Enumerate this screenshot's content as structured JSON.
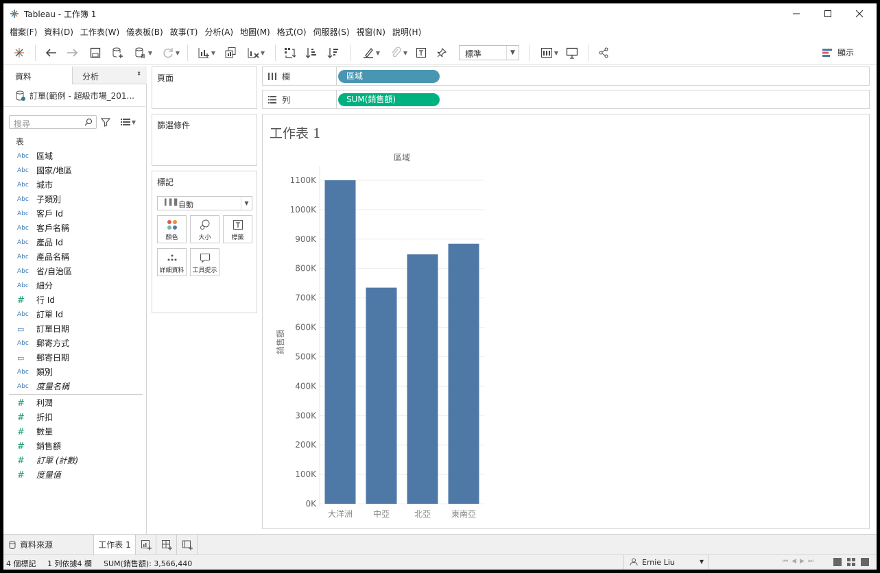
{
  "window": {
    "title": "Tableau - 工作簿 1"
  },
  "menu": [
    "檔案(F)",
    "資料(D)",
    "工作表(W)",
    "儀表板(B)",
    "故事(T)",
    "分析(A)",
    "地圖(M)",
    "格式(O)",
    "伺服器(S)",
    "視窗(N)",
    "說明(H)"
  ],
  "toolbar": {
    "fit_value": "標準",
    "show_me_label": "顯示"
  },
  "data_pane": {
    "tabs": [
      "資料",
      "分析"
    ],
    "datasource": "訂單(範例 - 超級市場_201...",
    "search_placeholder": "搜尋",
    "tables_label": "表",
    "dimensions": [
      {
        "type": "Abc",
        "name": "區域"
      },
      {
        "type": "Abc",
        "name": "國家/地區"
      },
      {
        "type": "Abc",
        "name": "城市"
      },
      {
        "type": "Abc",
        "name": "子類別"
      },
      {
        "type": "Abc",
        "name": "客戶 Id"
      },
      {
        "type": "Abc",
        "name": "客戶名稱"
      },
      {
        "type": "Abc",
        "name": "產品 Id"
      },
      {
        "type": "Abc",
        "name": "產品名稱"
      },
      {
        "type": "Abc",
        "name": "省/自治區"
      },
      {
        "type": "Abc",
        "name": "細分"
      },
      {
        "type": "#",
        "name": "行 Id"
      },
      {
        "type": "Abc",
        "name": "訂單 Id"
      },
      {
        "type": "date",
        "name": "訂單日期"
      },
      {
        "type": "Abc",
        "name": "郵寄方式"
      },
      {
        "type": "date",
        "name": "郵寄日期"
      },
      {
        "type": "Abc",
        "name": "類別"
      },
      {
        "type": "Abc",
        "name": "度量名稱",
        "italic": true
      }
    ],
    "measures": [
      {
        "type": "#",
        "name": "利潤"
      },
      {
        "type": "#",
        "name": "折扣"
      },
      {
        "type": "#",
        "name": "數量"
      },
      {
        "type": "#",
        "name": "銷售額"
      },
      {
        "type": "#",
        "name": "訂單 (計數)",
        "italic": true
      },
      {
        "type": "#",
        "name": "度量值",
        "italic": true
      }
    ]
  },
  "cards": {
    "pages_title": "頁面",
    "filters_title": "篩選條件",
    "marks_title": "標記",
    "mark_type": "自動",
    "buttons": [
      "顏色",
      "大小",
      "標籤",
      "詳細資料",
      "工具提示"
    ]
  },
  "shelves": {
    "columns_label": "欄",
    "columns_pill": "區域",
    "rows_label": "列",
    "rows_pill": "SUM(銷售額)"
  },
  "viz": {
    "sheet_title": "工作表 1",
    "column_header": "區域"
  },
  "chart_data": {
    "type": "bar",
    "categories": [
      "大洋洲",
      "中亞",
      "北亞",
      "東南亞"
    ],
    "values": [
      1100000,
      735000,
      848000,
      884000
    ],
    "title": "工作表 1",
    "xlabel": "區域",
    "ylabel": "銷售額",
    "ylim": [
      0,
      1100000
    ],
    "y_ticks": [
      "0K",
      "100K",
      "200K",
      "300K",
      "400K",
      "500K",
      "600K",
      "700K",
      "800K",
      "900K",
      "1000K",
      "1100K"
    ],
    "bar_color": "#4e79a7",
    "grid": true
  },
  "sheet_tabs": {
    "datasource_tab": "資料來源",
    "sheet_tab": "工作表 1"
  },
  "status": {
    "marks": "4 個標記",
    "rows_cols": "1 列依據4 欄",
    "sum": "SUM(銷售額): 3,566,440",
    "user": "Ernie Liu"
  },
  "colors": {
    "dim_pill": "#4996b2",
    "measure_pill": "#00b180",
    "dim_icon": "#3a78b5",
    "measure_icon": "#1b9e77"
  }
}
